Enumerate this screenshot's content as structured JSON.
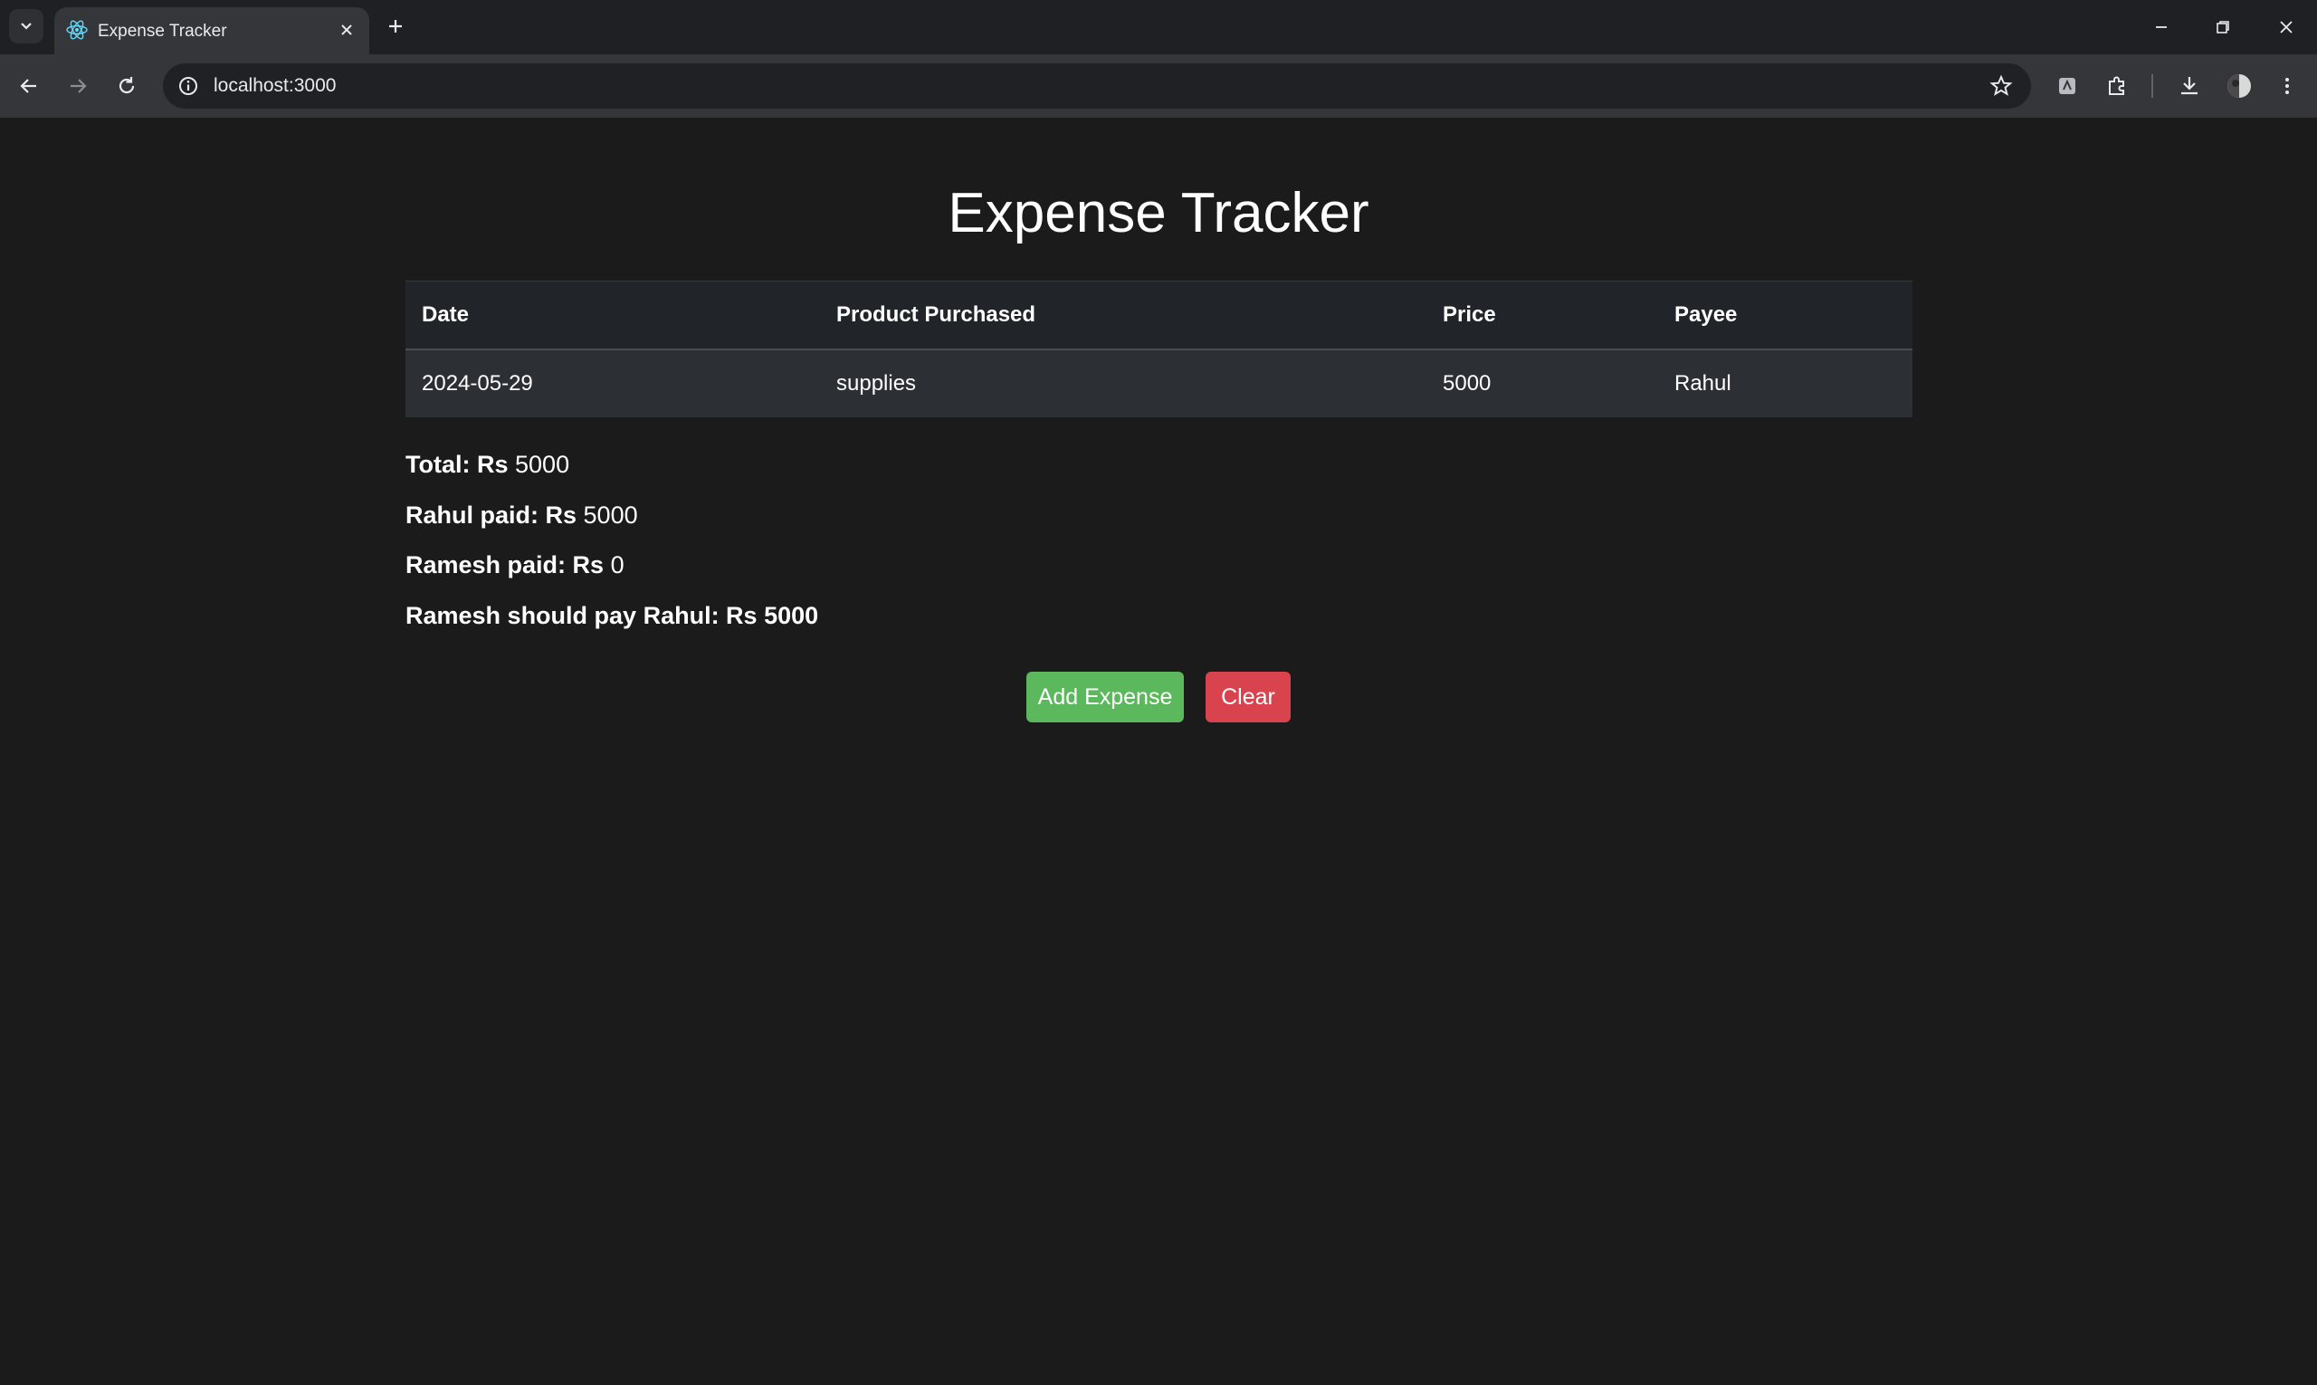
{
  "browser": {
    "tab_title": "Expense Tracker",
    "url": "localhost:3000"
  },
  "page": {
    "title": "Expense Tracker",
    "table": {
      "headers": [
        "Date",
        "Product Purchased",
        "Price",
        "Payee"
      ],
      "rows": [
        [
          "2024-05-29",
          "supplies",
          "5000",
          "Rahul"
        ]
      ]
    },
    "summary": {
      "total_label": "Total: Rs",
      "total_value": "5000",
      "rahul_label": "Rahul paid: Rs",
      "rahul_value": "5000",
      "ramesh_label": "Ramesh paid: Rs",
      "ramesh_value": "0",
      "settlement": "Ramesh should pay Rahul: Rs 5000"
    },
    "buttons": {
      "add_label": "Add Expense",
      "clear_label": "Clear"
    }
  },
  "colors": {
    "background": "#1b1b1c",
    "add_button": "#5cb85c",
    "clear_button": "#d9434e"
  }
}
